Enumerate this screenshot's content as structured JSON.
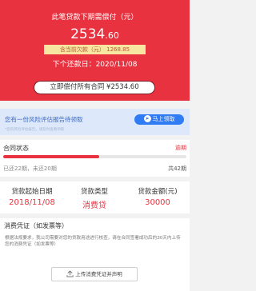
{
  "header": {
    "title": "此笔贷款下期需偿付（元）",
    "amount_int": "2534",
    "amount_dec": ".60",
    "overdue_text": "含当前欠款（元）  1268.85",
    "next_date": "下个还款日：2020/11/08",
    "pay_button": "立即偿付所有合同 ¥2534.60"
  },
  "risk_banner": {
    "title": "您有一份风险评估报告待领取",
    "subtitle": "*您的风险评估报告，请及时查看领取",
    "button": "马上领取",
    "arrow_icon": "arrow-right-icon"
  },
  "contract_status": {
    "title": "合同状态",
    "tag": "逾期",
    "progress": 0.524,
    "left_text": "已还22期，未还20期",
    "right_text": "共42期"
  },
  "loan_info": {
    "start_date_label": "贷款起始日期",
    "start_date_value": "2018/11/08",
    "type_label": "贷款类型",
    "type_value": "消费贷",
    "amount_label": "贷款金额(元)",
    "amount_value": "30000"
  },
  "voucher": {
    "title": "消费凭证（如发票等）",
    "description": "根据法规要求，我公司需要对您的贷款用途进行核查，请在合同签署成功后的30天内上传您的消费凭证（如发票等）",
    "upload_button": "上传消费凭证并声明",
    "upload_icon": "upload-icon"
  },
  "colors": {
    "brand_red": "#e8323f",
    "banner_blue": "#2f7cf4",
    "banner_bg": "#dde9fb"
  }
}
